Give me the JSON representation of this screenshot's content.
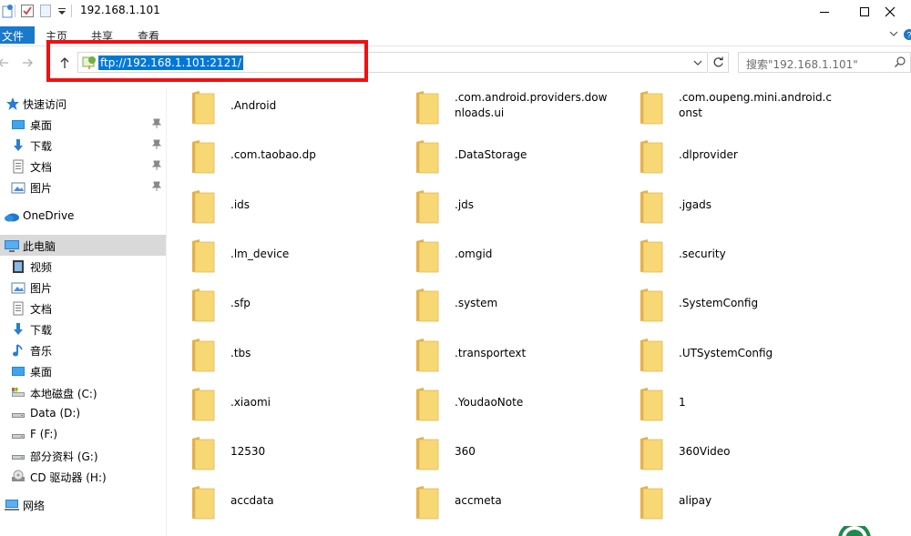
{
  "window": {
    "title": "192.168.1.101"
  },
  "ribbon": {
    "tabs": [
      "文件",
      "主页",
      "共享",
      "查看"
    ]
  },
  "address": {
    "value": "ftp://192.168.1.101:2121/"
  },
  "search": {
    "placeholder": "搜索\"192.168.1.101\""
  },
  "colors": {
    "accent": "#1979ca",
    "selection": "#0078d7",
    "highlight": "#ee1111",
    "folder": "#f5c86a"
  },
  "sidebar": {
    "items": [
      {
        "label": "快速访问",
        "icon": "star-icon"
      },
      {
        "label": "桌面",
        "icon": "desktop-icon",
        "pinned": true
      },
      {
        "label": "下载",
        "icon": "download-icon",
        "pinned": true
      },
      {
        "label": "文档",
        "icon": "document-icon",
        "pinned": true
      },
      {
        "label": "图片",
        "icon": "picture-icon",
        "pinned": true
      },
      {
        "label": "OneDrive",
        "icon": "cloud-icon"
      },
      {
        "label": "此电脑",
        "icon": "computer-icon",
        "selected": true
      },
      {
        "label": "视频",
        "icon": "video-icon"
      },
      {
        "label": "图片",
        "icon": "picture-icon"
      },
      {
        "label": "文档",
        "icon": "document-icon"
      },
      {
        "label": "下载",
        "icon": "download-icon"
      },
      {
        "label": "音乐",
        "icon": "music-icon"
      },
      {
        "label": "桌面",
        "icon": "desktop-icon"
      },
      {
        "label": "本地磁盘 (C:)",
        "icon": "drive-c-icon"
      },
      {
        "label": "Data (D:)",
        "icon": "drive-icon"
      },
      {
        "label": "F (F:)",
        "icon": "drive-icon"
      },
      {
        "label": "部分资料 (G:)",
        "icon": "drive-icon"
      },
      {
        "label": "CD 驱动器 (H:)",
        "icon": "cd-drive-icon"
      },
      {
        "label": "网络",
        "icon": "network-icon"
      }
    ]
  },
  "folders": [
    ".Android",
    ".com.android.providers.downloads.ui",
    ".com.oupeng.mini.android.const",
    ".com.taobao.dp",
    ".DataStorage",
    ".dlprovider",
    ".ids",
    ".jds",
    ".jgads",
    ".lm_device",
    ".omgid",
    ".security",
    ".sfp",
    ".system",
    ".SystemConfig",
    ".tbs",
    ".transportext",
    ".UTSystemConfig",
    ".xiaomi",
    ".YoudaoNote",
    "1",
    "12530",
    "360",
    "360Video",
    "accdata",
    "accmeta",
    "alipay"
  ]
}
